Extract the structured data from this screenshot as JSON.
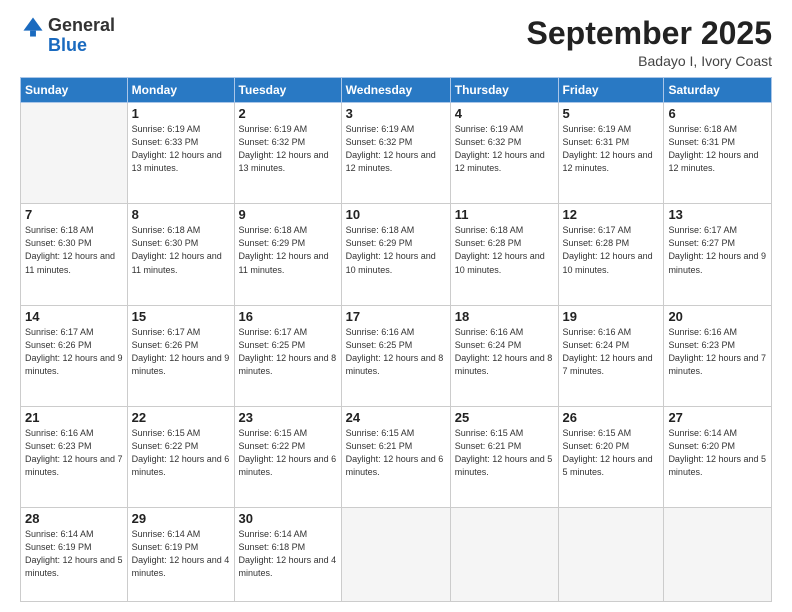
{
  "logo": {
    "general": "General",
    "blue": "Blue"
  },
  "header": {
    "month_title": "September 2025",
    "location": "Badayo I, Ivory Coast"
  },
  "days_of_week": [
    "Sunday",
    "Monday",
    "Tuesday",
    "Wednesday",
    "Thursday",
    "Friday",
    "Saturday"
  ],
  "weeks": [
    [
      {
        "day": "",
        "info": ""
      },
      {
        "day": "1",
        "info": "Sunrise: 6:19 AM\nSunset: 6:33 PM\nDaylight: 12 hours\nand 13 minutes."
      },
      {
        "day": "2",
        "info": "Sunrise: 6:19 AM\nSunset: 6:32 PM\nDaylight: 12 hours\nand 13 minutes."
      },
      {
        "day": "3",
        "info": "Sunrise: 6:19 AM\nSunset: 6:32 PM\nDaylight: 12 hours\nand 12 minutes."
      },
      {
        "day": "4",
        "info": "Sunrise: 6:19 AM\nSunset: 6:32 PM\nDaylight: 12 hours\nand 12 minutes."
      },
      {
        "day": "5",
        "info": "Sunrise: 6:19 AM\nSunset: 6:31 PM\nDaylight: 12 hours\nand 12 minutes."
      },
      {
        "day": "6",
        "info": "Sunrise: 6:18 AM\nSunset: 6:31 PM\nDaylight: 12 hours\nand 12 minutes."
      }
    ],
    [
      {
        "day": "7",
        "info": "Sunrise: 6:18 AM\nSunset: 6:30 PM\nDaylight: 12 hours\nand 11 minutes."
      },
      {
        "day": "8",
        "info": "Sunrise: 6:18 AM\nSunset: 6:30 PM\nDaylight: 12 hours\nand 11 minutes."
      },
      {
        "day": "9",
        "info": "Sunrise: 6:18 AM\nSunset: 6:29 PM\nDaylight: 12 hours\nand 11 minutes."
      },
      {
        "day": "10",
        "info": "Sunrise: 6:18 AM\nSunset: 6:29 PM\nDaylight: 12 hours\nand 10 minutes."
      },
      {
        "day": "11",
        "info": "Sunrise: 6:18 AM\nSunset: 6:28 PM\nDaylight: 12 hours\nand 10 minutes."
      },
      {
        "day": "12",
        "info": "Sunrise: 6:17 AM\nSunset: 6:28 PM\nDaylight: 12 hours\nand 10 minutes."
      },
      {
        "day": "13",
        "info": "Sunrise: 6:17 AM\nSunset: 6:27 PM\nDaylight: 12 hours\nand 9 minutes."
      }
    ],
    [
      {
        "day": "14",
        "info": "Sunrise: 6:17 AM\nSunset: 6:26 PM\nDaylight: 12 hours\nand 9 minutes."
      },
      {
        "day": "15",
        "info": "Sunrise: 6:17 AM\nSunset: 6:26 PM\nDaylight: 12 hours\nand 9 minutes."
      },
      {
        "day": "16",
        "info": "Sunrise: 6:17 AM\nSunset: 6:25 PM\nDaylight: 12 hours\nand 8 minutes."
      },
      {
        "day": "17",
        "info": "Sunrise: 6:16 AM\nSunset: 6:25 PM\nDaylight: 12 hours\nand 8 minutes."
      },
      {
        "day": "18",
        "info": "Sunrise: 6:16 AM\nSunset: 6:24 PM\nDaylight: 12 hours\nand 8 minutes."
      },
      {
        "day": "19",
        "info": "Sunrise: 6:16 AM\nSunset: 6:24 PM\nDaylight: 12 hours\nand 7 minutes."
      },
      {
        "day": "20",
        "info": "Sunrise: 6:16 AM\nSunset: 6:23 PM\nDaylight: 12 hours\nand 7 minutes."
      }
    ],
    [
      {
        "day": "21",
        "info": "Sunrise: 6:16 AM\nSunset: 6:23 PM\nDaylight: 12 hours\nand 7 minutes."
      },
      {
        "day": "22",
        "info": "Sunrise: 6:15 AM\nSunset: 6:22 PM\nDaylight: 12 hours\nand 6 minutes."
      },
      {
        "day": "23",
        "info": "Sunrise: 6:15 AM\nSunset: 6:22 PM\nDaylight: 12 hours\nand 6 minutes."
      },
      {
        "day": "24",
        "info": "Sunrise: 6:15 AM\nSunset: 6:21 PM\nDaylight: 12 hours\nand 6 minutes."
      },
      {
        "day": "25",
        "info": "Sunrise: 6:15 AM\nSunset: 6:21 PM\nDaylight: 12 hours\nand 5 minutes."
      },
      {
        "day": "26",
        "info": "Sunrise: 6:15 AM\nSunset: 6:20 PM\nDaylight: 12 hours\nand 5 minutes."
      },
      {
        "day": "27",
        "info": "Sunrise: 6:14 AM\nSunset: 6:20 PM\nDaylight: 12 hours\nand 5 minutes."
      }
    ],
    [
      {
        "day": "28",
        "info": "Sunrise: 6:14 AM\nSunset: 6:19 PM\nDaylight: 12 hours\nand 5 minutes."
      },
      {
        "day": "29",
        "info": "Sunrise: 6:14 AM\nSunset: 6:19 PM\nDaylight: 12 hours\nand 4 minutes."
      },
      {
        "day": "30",
        "info": "Sunrise: 6:14 AM\nSunset: 6:18 PM\nDaylight: 12 hours\nand 4 minutes."
      },
      {
        "day": "",
        "info": ""
      },
      {
        "day": "",
        "info": ""
      },
      {
        "day": "",
        "info": ""
      },
      {
        "day": "",
        "info": ""
      }
    ]
  ]
}
